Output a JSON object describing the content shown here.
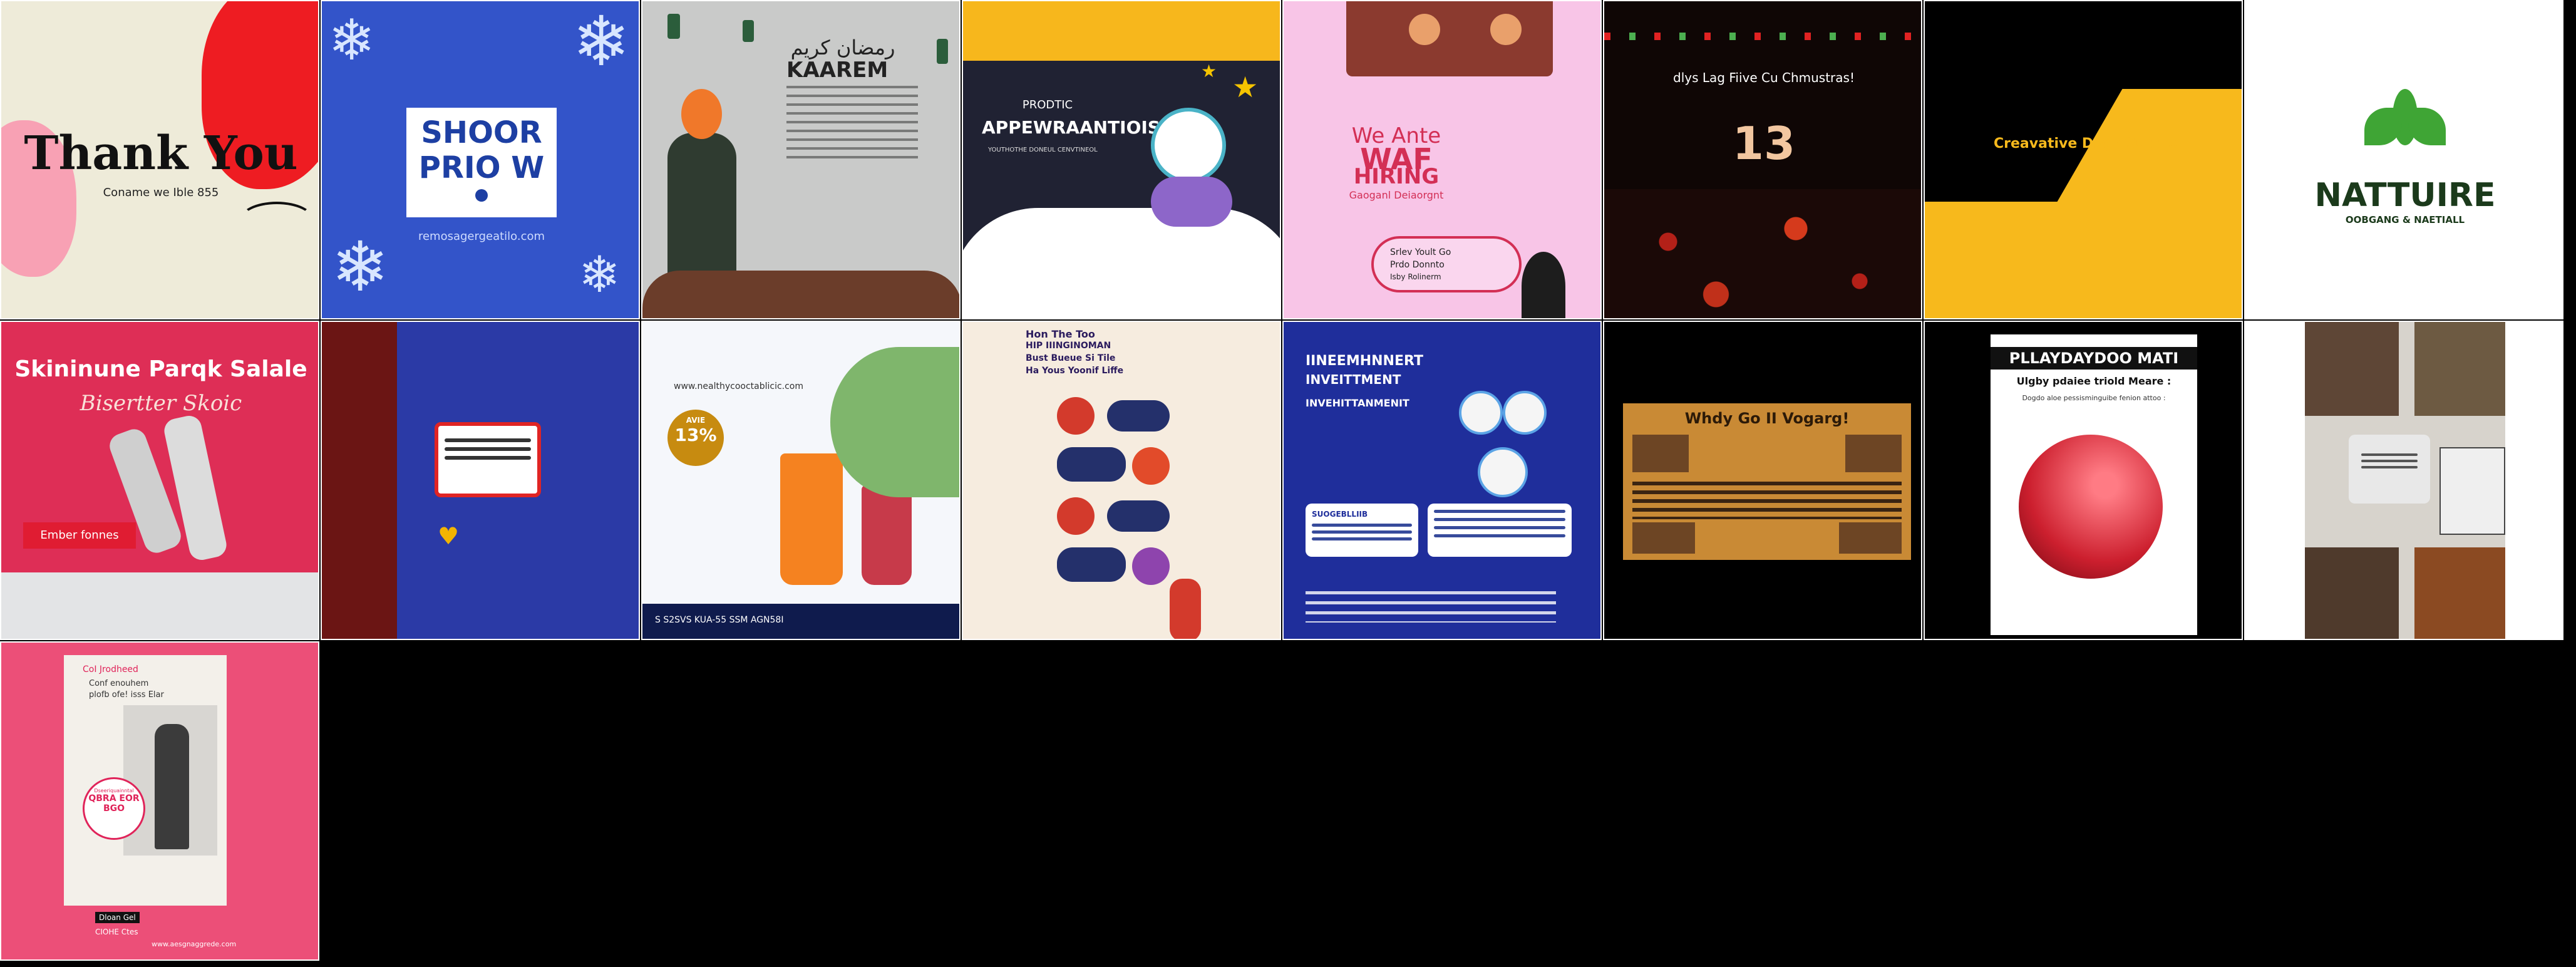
{
  "tiles": [
    {
      "id": "thank-you",
      "title": "Thank You",
      "subtitle": "Coname we Ible 855"
    },
    {
      "id": "shoor-priow",
      "line1": "SHOOR",
      "line2": "PRIO W",
      "footer": "remosagergeatilo.com"
    },
    {
      "id": "kaarem",
      "arabic": "رمضان كريم",
      "title": "KAAREM"
    },
    {
      "id": "appewraantiois",
      "kicker": "PRODTIC",
      "title": "APPEWRAANTIOIS",
      "subtitle": "YOUTHOTHE DONEUL CENVTINEOL"
    },
    {
      "id": "we-are-hiring",
      "line1": "We Ante",
      "line2": "WAF",
      "line3": "HIRING",
      "line4": "Gaoganl Deiaorgnt",
      "bubble1": "Srlev Yoult Go",
      "bubble2": "Prdo Donnto",
      "bubble3": "Isby Rolinerm"
    },
    {
      "id": "christmas",
      "headline": "dlys Lag Fiive Cu Chmustras!",
      "number": "13"
    },
    {
      "id": "creative-design",
      "title": "Creavative Dsgn Suttiio"
    },
    {
      "id": "natture",
      "title": "NATTUIRE",
      "subtitle": "OOBGANG & NAETIALL"
    },
    {
      "id": "skincare",
      "title": "Skininune Parqk Salale",
      "script": "Bisertter Skoic",
      "button": "Ember fonnes"
    },
    {
      "id": "window-dialog"
    },
    {
      "id": "juice",
      "url": "www.nealthycooctablicic.com",
      "badge": "13%",
      "badge_top": "AVIE",
      "footer": "S S2SVS   KUA-55   SSM  AGN58I"
    },
    {
      "id": "infographic",
      "line1": "Hon The Too",
      "line2": "HIP IIINGINOMAN",
      "line3": "Bust Bueue Si Tile",
      "line4": "Ha Yous Yoonif Liffe"
    },
    {
      "id": "investment",
      "title": "IINEEMHNNERT",
      "subtitle": "INVEITTMENT",
      "headline": "INVEHITTANMENIT",
      "tag": "SUOGEBLLIIB"
    },
    {
      "id": "why-go",
      "headline": "Whdy Go II Vogarg!"
    },
    {
      "id": "playdaydoo",
      "title": "PLLAYDAYDOO MATI",
      "subtitle": "Ulgby pdaiee triold Meare :",
      "text": "Dogdo aloe pessisminguibe fenion attoo :"
    },
    {
      "id": "collage"
    },
    {
      "id": "pink-fashion",
      "label": "CoI Jrodheed",
      "text1": "Conf enouhem",
      "text2": "plofb ofe! isss Elar",
      "stamp1": "Dseeriquainntal",
      "stamp2": "QBRA EOR",
      "stamp3": "BGO",
      "footer1": "Dloan Gel",
      "footer2": "CIOHE Ctes",
      "footer3": "www.aesgnaggrede.com"
    }
  ]
}
